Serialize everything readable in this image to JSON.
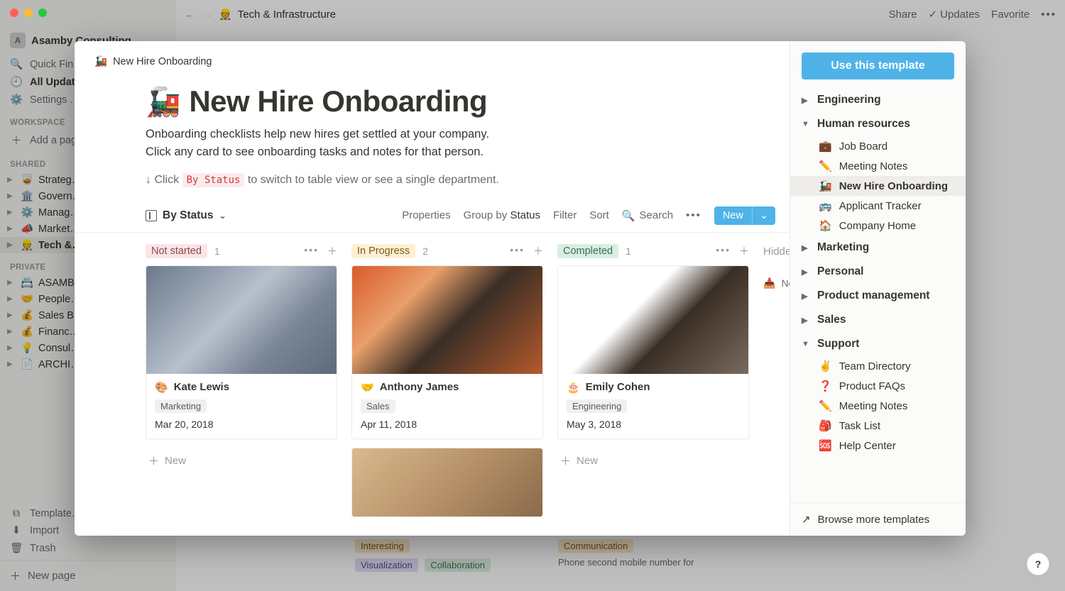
{
  "topbar": {
    "breadcrumb_emoji": "👷",
    "breadcrumb": "Tech & Infrastructure",
    "share": "Share",
    "updates": "Updates",
    "favorite": "Favorite"
  },
  "sidebar": {
    "workspace": "Asamby Consulting",
    "workspace_initial": "A",
    "quick_find": "Quick Fin…",
    "all_updates": "All Updat…",
    "settings": "Settings …",
    "section_workspace": "WORKSPACE",
    "add_page": "Add a pag…",
    "section_shared": "SHARED",
    "shared_items": [
      {
        "emoji": "🥃",
        "label": "Strateg…"
      },
      {
        "emoji": "🏛️",
        "label": "Govern…"
      },
      {
        "emoji": "⚙️",
        "label": "Manag…"
      },
      {
        "emoji": "📣",
        "label": "Market…"
      },
      {
        "emoji": "👷",
        "label": "Tech &…"
      }
    ],
    "section_private": "PRIVATE",
    "private_items": [
      {
        "emoji": "📇",
        "label": "ASAMB…"
      },
      {
        "emoji": "🤝",
        "label": "People…"
      },
      {
        "emoji": "💰",
        "label": "Sales B…"
      },
      {
        "emoji": "💰",
        "label": "Financ…"
      },
      {
        "emoji": "💡",
        "label": "Consul…"
      },
      {
        "emoji": "📄",
        "label": "ARCHI…"
      }
    ],
    "templates": "Template…",
    "import": "Import",
    "trash": "Trash",
    "new_page": "New page"
  },
  "modal": {
    "crumb_emoji": "🚂",
    "crumb": "New Hire Onboarding",
    "title": "New Hire Onboarding",
    "desc1": "Onboarding checklists help new hires get settled at your company.",
    "desc2": "Click any card to see onboarding tasks and notes for that person.",
    "hint_prefix": "↓ Click ",
    "hint_code": "By Status",
    "hint_suffix": " to switch to table view or see a single department.",
    "view_label": "By Status",
    "tools": {
      "properties": "Properties",
      "group_by": "Group by",
      "group_by_value": "Status",
      "filter": "Filter",
      "sort": "Sort",
      "search": "Search",
      "new": "New"
    },
    "columns": [
      {
        "status": "Not started",
        "count": "1",
        "pill": "pill-notstarted",
        "cards": [
          {
            "emoji": "🎨",
            "name": "Kate Lewis",
            "dept": "Marketing",
            "date": "Mar 20, 2018",
            "cover": "kate"
          }
        ],
        "new": "New"
      },
      {
        "status": "In Progress",
        "count": "2",
        "pill": "pill-progress",
        "cards": [
          {
            "emoji": "🤝",
            "name": "Anthony James",
            "dept": "Sales",
            "date": "Apr 11, 2018",
            "cover": "anthony"
          },
          {
            "emoji": "",
            "name": "",
            "dept": "",
            "date": "",
            "cover": "extra"
          }
        ]
      },
      {
        "status": "Completed",
        "count": "1",
        "pill": "pill-completed",
        "cards": [
          {
            "emoji": "🎂",
            "name": "Emily Cohen",
            "dept": "Engineering",
            "date": "May 3, 2018",
            "cover": "emily"
          }
        ],
        "new": "New"
      }
    ],
    "hidden_label": "Hidden",
    "no_status_label": "No"
  },
  "template_sidebar": {
    "use_button": "Use this template",
    "cats": [
      {
        "label": "Engineering",
        "open": false
      },
      {
        "label": "Human resources",
        "open": true,
        "items": [
          {
            "emoji": "💼",
            "label": "Job Board"
          },
          {
            "emoji": "✏️",
            "label": "Meeting Notes"
          },
          {
            "emoji": "🚂",
            "label": "New Hire Onboarding",
            "selected": true
          },
          {
            "emoji": "🚌",
            "label": "Applicant Tracker"
          },
          {
            "emoji": "🏠",
            "label": "Company Home"
          }
        ]
      },
      {
        "label": "Marketing",
        "open": false
      },
      {
        "label": "Personal",
        "open": false
      },
      {
        "label": "Product management",
        "open": false
      },
      {
        "label": "Sales",
        "open": false
      },
      {
        "label": "Support",
        "open": true,
        "items": [
          {
            "emoji": "✌️",
            "label": "Team Directory"
          },
          {
            "emoji": "❓",
            "label": "Product FAQs"
          },
          {
            "emoji": "✏️",
            "label": "Meeting Notes"
          },
          {
            "emoji": "🎒",
            "label": "Task List"
          },
          {
            "emoji": "🆘",
            "label": "Help Center"
          }
        ]
      }
    ],
    "browse": "Browse more templates"
  },
  "bg_fragments": {
    "tag_interesting": "Interesting",
    "tag_visualization": "Visualization",
    "tag_collaboration": "Collaboration",
    "tag_communication": "Communication",
    "desc": "Phone second mobile number for"
  }
}
